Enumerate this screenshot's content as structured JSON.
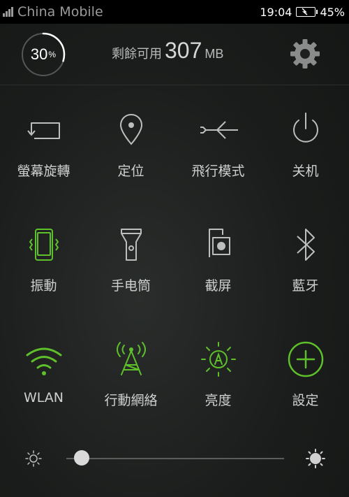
{
  "status_bar": {
    "carrier": "China Mobile",
    "time": "19:04",
    "battery": "45%"
  },
  "memory": {
    "usage_percent_label": "30",
    "percent_sign": "%",
    "usage_fraction": 0.3,
    "available_label": "剩餘可用",
    "available_value": "307",
    "available_unit": "MB"
  },
  "toggles": [
    {
      "label": "螢幕旋轉",
      "icon": "screen-rotation-icon",
      "active": false
    },
    {
      "label": "定位",
      "icon": "location-icon",
      "active": false
    },
    {
      "label": "飛行模式",
      "icon": "airplane-icon",
      "active": false
    },
    {
      "label": "关机",
      "icon": "power-icon",
      "active": false
    },
    {
      "label": "振動",
      "icon": "vibrate-icon",
      "active": true
    },
    {
      "label": "手电筒",
      "icon": "flashlight-icon",
      "active": false
    },
    {
      "label": "截屏",
      "icon": "screenshot-icon",
      "active": false
    },
    {
      "label": "藍牙",
      "icon": "bluetooth-icon",
      "active": false
    },
    {
      "label": "WLAN",
      "icon": "wifi-icon",
      "active": true
    },
    {
      "label": "行動網絡",
      "icon": "mobile-network-icon",
      "active": true
    },
    {
      "label": "亮度",
      "icon": "brightness-auto-icon",
      "active": true
    },
    {
      "label": "設定",
      "icon": "add-settings-icon",
      "active": true
    }
  ],
  "brightness": {
    "level_fraction": 0.07,
    "min_icon": "brightness-low-icon",
    "max_icon": "brightness-high-icon"
  },
  "colors": {
    "active": "#5ec02a",
    "inactive": "#bdbdbd",
    "background": "#1b1d1c"
  }
}
